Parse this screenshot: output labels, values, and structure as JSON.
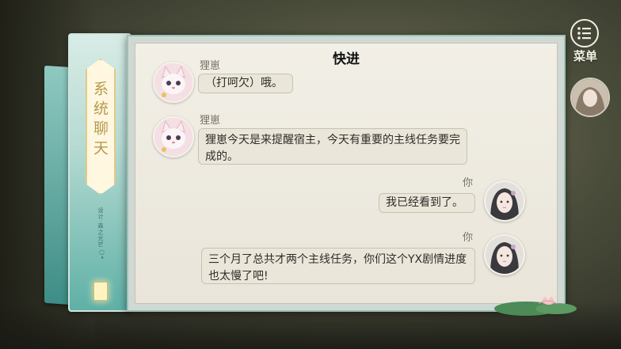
{
  "panel": {
    "title": "系统聊天",
    "credit": "设计·森之光芒"
  },
  "controls": {
    "fast_forward": "快进",
    "menu": "菜单"
  },
  "messages": [
    {
      "side": "left",
      "name": "狸崽",
      "text": "（打呵欠）哦。",
      "avatar": "cat-avatar"
    },
    {
      "side": "left",
      "name": "狸崽",
      "text": "狸崽今天是来提醒宿主，今天有重要的主线任务要完成的。",
      "avatar": "cat-avatar"
    },
    {
      "side": "right",
      "name": "你",
      "text": "我已经看到了。",
      "avatar": "girl-avatar"
    },
    {
      "side": "right",
      "name": "你",
      "text": "三个月了总共才两个主线任务，你们这个YX剧情进度也太慢了吧!",
      "avatar": "girl-avatar"
    }
  ],
  "colors": {
    "accent_teal": "#5fb0a6",
    "paper": "#f2efe6",
    "bubble": "#ebe6da",
    "gold": "#b59a4c"
  }
}
